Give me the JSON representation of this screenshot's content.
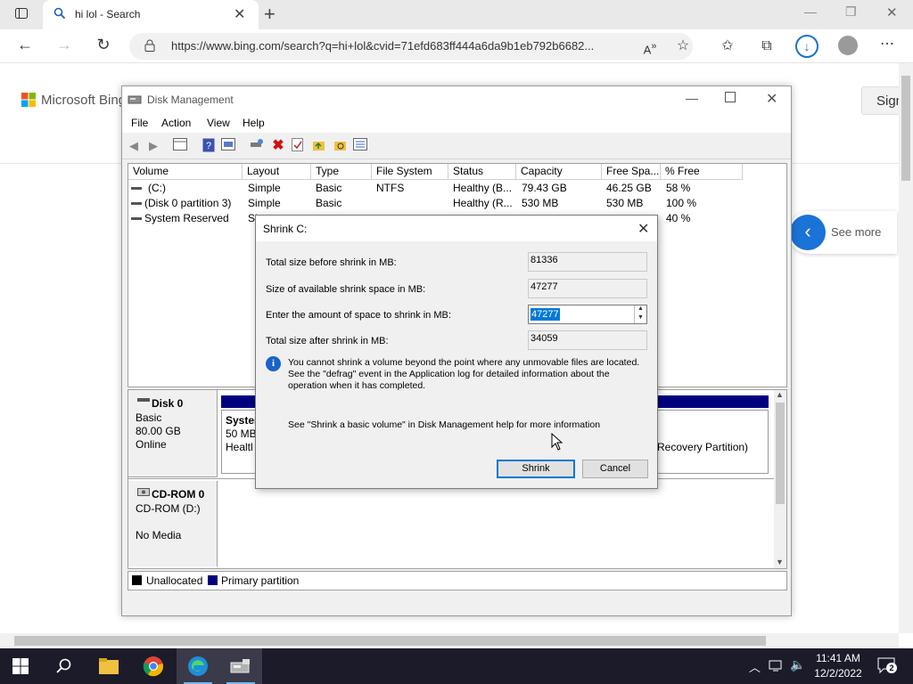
{
  "browser": {
    "tab_title": "hi lol - Search",
    "url": "https://www.bing.com/search?q=hi+lol&cvid=71efd683ff444a6da9b1eb792b6682..."
  },
  "bing": {
    "logo_text": "Microsoft Bing",
    "signin": "Sign",
    "see_more": "See more"
  },
  "disk_mgmt": {
    "title": "Disk Management",
    "menu": [
      "File",
      "Action",
      "View",
      "Help"
    ],
    "columns": [
      "Volume",
      "Layout",
      "Type",
      "File System",
      "Status",
      "Capacity",
      "Free Spa...",
      "% Free"
    ],
    "volumes": [
      [
        "(C:)",
        "Simple",
        "Basic",
        "NTFS",
        "Healthy (B...",
        "79.43 GB",
        "46.25 GB",
        "58 %"
      ],
      [
        "(Disk 0 partition 3)",
        "Simple",
        "Basic",
        "",
        "Healthy (R...",
        "530 MB",
        "530 MB",
        "100 %"
      ],
      [
        "System Reserved",
        "Si",
        "",
        "",
        "",
        "",
        "",
        "40 %"
      ]
    ],
    "disk0": {
      "name": "Disk 0",
      "type": "Basic",
      "size": "80.00 GB",
      "status": "Online",
      "part1_title": "Syster",
      "part1_size": "50 MB",
      "part1_status": "Healtl",
      "part3_label": "Recovery Partition)"
    },
    "cdrom": {
      "name": "CD-ROM 0",
      "drive": "CD-ROM (D:)",
      "media": "No Media"
    },
    "legend": {
      "unallocated": "Unallocated",
      "primary": "Primary partition"
    }
  },
  "dialog": {
    "title": "Shrink C:",
    "total_before_label": "Total size before shrink in MB:",
    "total_before": "81336",
    "available_label": "Size of available shrink space in MB:",
    "available": "47277",
    "amount_label": "Enter the amount of space to shrink in MB:",
    "amount": "47277",
    "after_label": "Total size after shrink in MB:",
    "after": "34059",
    "info_line1": "You cannot shrink a volume beyond the point where any unmovable files are located.",
    "info_line2": "See the \"defrag\" event in the Application log for detailed information about the",
    "info_line3": "operation when it has completed.",
    "help_text": "See \"Shrink a basic volume\" in Disk Management help for more information",
    "shrink_button": "Shrink",
    "cancel_button": "Cancel"
  },
  "taskbar": {
    "time": "11:41 AM",
    "date": "12/2/2022",
    "notifications": "2"
  }
}
